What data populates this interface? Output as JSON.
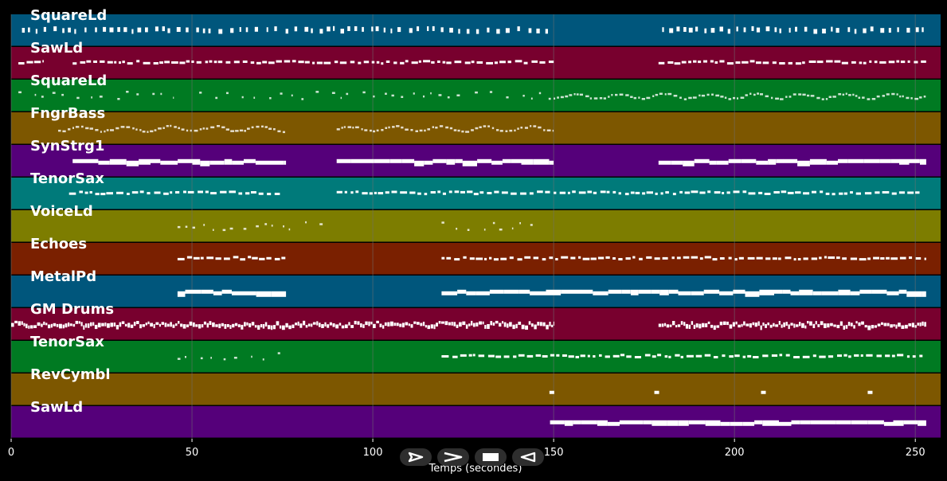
{
  "xlabel": "Temps (secondes)",
  "xlim": [
    0,
    257
  ],
  "xticks": [
    0,
    50,
    100,
    150,
    200,
    250
  ],
  "note_color": "#ffffff",
  "grid_color": "#6f6f6f",
  "controls": [
    {
      "name": "play-icon"
    },
    {
      "name": "forward-icon"
    },
    {
      "name": "stop-icon"
    },
    {
      "name": "rewind-icon"
    }
  ],
  "tracks": [
    {
      "name": "SquareLd",
      "color": "#00567c",
      "segments": [
        [
          3,
          150,
          "blip"
        ],
        [
          180,
          254,
          "blip"
        ]
      ]
    },
    {
      "name": "SawLd",
      "color": "#78002e",
      "segments": [
        [
          2,
          9,
          "dash"
        ],
        [
          17,
          150,
          "dash"
        ],
        [
          179,
          253,
          "dash"
        ]
      ]
    },
    {
      "name": "SquareLd",
      "color": "#007a22",
      "segments": [
        [
          2,
          45,
          "sparse"
        ],
        [
          52,
          150,
          "sparse"
        ],
        [
          150,
          253,
          "wavy"
        ]
      ]
    },
    {
      "name": "FngrBass",
      "color": "#7d5700",
      "segments": [
        [
          13,
          76,
          "wavy"
        ],
        [
          90,
          150,
          "wavy"
        ]
      ]
    },
    {
      "name": "SynStrg1",
      "color": "#55007a",
      "segments": [
        [
          17,
          76,
          "block"
        ],
        [
          90,
          150,
          "block"
        ],
        [
          179,
          253,
          "block"
        ]
      ]
    },
    {
      "name": "TenorSax",
      "color": "#007a7a",
      "segments": [
        [
          16,
          75,
          "dash"
        ],
        [
          90,
          150,
          "dash"
        ],
        [
          150,
          252,
          "dash"
        ]
      ]
    },
    {
      "name": "VoiceLd",
      "color": "#7d7d00",
      "segments": [
        [
          46,
          87,
          "sparse"
        ],
        [
          119,
          146,
          "sparse"
        ]
      ]
    },
    {
      "name": "Echoes",
      "color": "#7a2000",
      "segments": [
        [
          46,
          76,
          "dash"
        ],
        [
          119,
          253,
          "dash"
        ]
      ]
    },
    {
      "name": "MetalPd",
      "color": "#00567c",
      "segments": [
        [
          46,
          76,
          "block"
        ],
        [
          119,
          253,
          "block"
        ]
      ]
    },
    {
      "name": "GM Drums",
      "color": "#78002e",
      "segments": [
        [
          0,
          150,
          "drum"
        ],
        [
          179,
          253,
          "drum"
        ]
      ]
    },
    {
      "name": "TenorSax",
      "color": "#007a22",
      "segments": [
        [
          46,
          75,
          "sparse"
        ],
        [
          119,
          252,
          "dash"
        ]
      ]
    },
    {
      "name": "RevCymbl",
      "color": "#7d5700",
      "notes": [
        149.5,
        178.5,
        208,
        237.5
      ]
    },
    {
      "name": "SawLd",
      "color": "#55007a",
      "segments": [
        [
          149,
          253,
          "block"
        ]
      ]
    }
  ]
}
